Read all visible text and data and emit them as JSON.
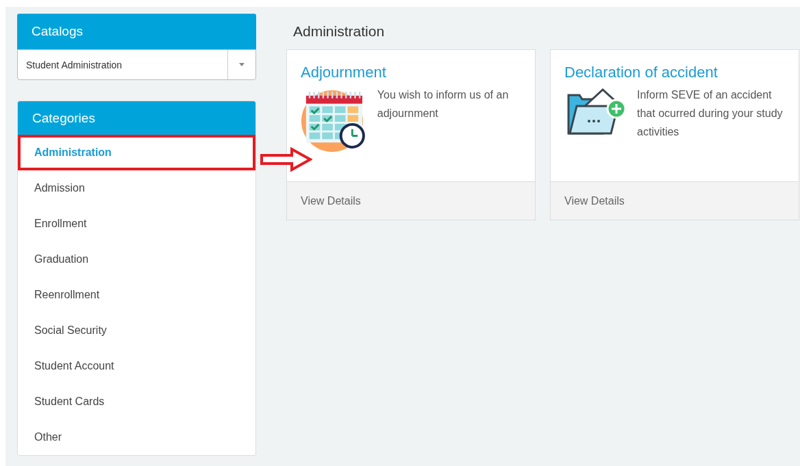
{
  "catalogs": {
    "title": "Catalogs",
    "select": {
      "value": "Student Administration"
    }
  },
  "categories": {
    "title": "Categories",
    "items": [
      {
        "label": "Administration",
        "selected": true,
        "highlighted": true
      },
      {
        "label": "Admission",
        "selected": false,
        "highlighted": false
      },
      {
        "label": "Enrollment",
        "selected": false,
        "highlighted": false
      },
      {
        "label": "Graduation",
        "selected": false,
        "highlighted": false
      },
      {
        "label": "Reenrollment",
        "selected": false,
        "highlighted": false
      },
      {
        "label": "Social Security",
        "selected": false,
        "highlighted": false
      },
      {
        "label": "Student Account",
        "selected": false,
        "highlighted": false
      },
      {
        "label": "Student Cards",
        "selected": false,
        "highlighted": false
      },
      {
        "label": "Other",
        "selected": false,
        "highlighted": false
      }
    ]
  },
  "main": {
    "title": "Administration",
    "cards": [
      {
        "kind": "calendar",
        "title": "Adjournment",
        "description": "You wish to inform us of an adjournment",
        "footer": "View Details"
      },
      {
        "kind": "folder",
        "title": "Declaration of accident",
        "description": "Inform SEVE of an accident that ocurred during your study activities",
        "footer": "View Details"
      }
    ]
  }
}
